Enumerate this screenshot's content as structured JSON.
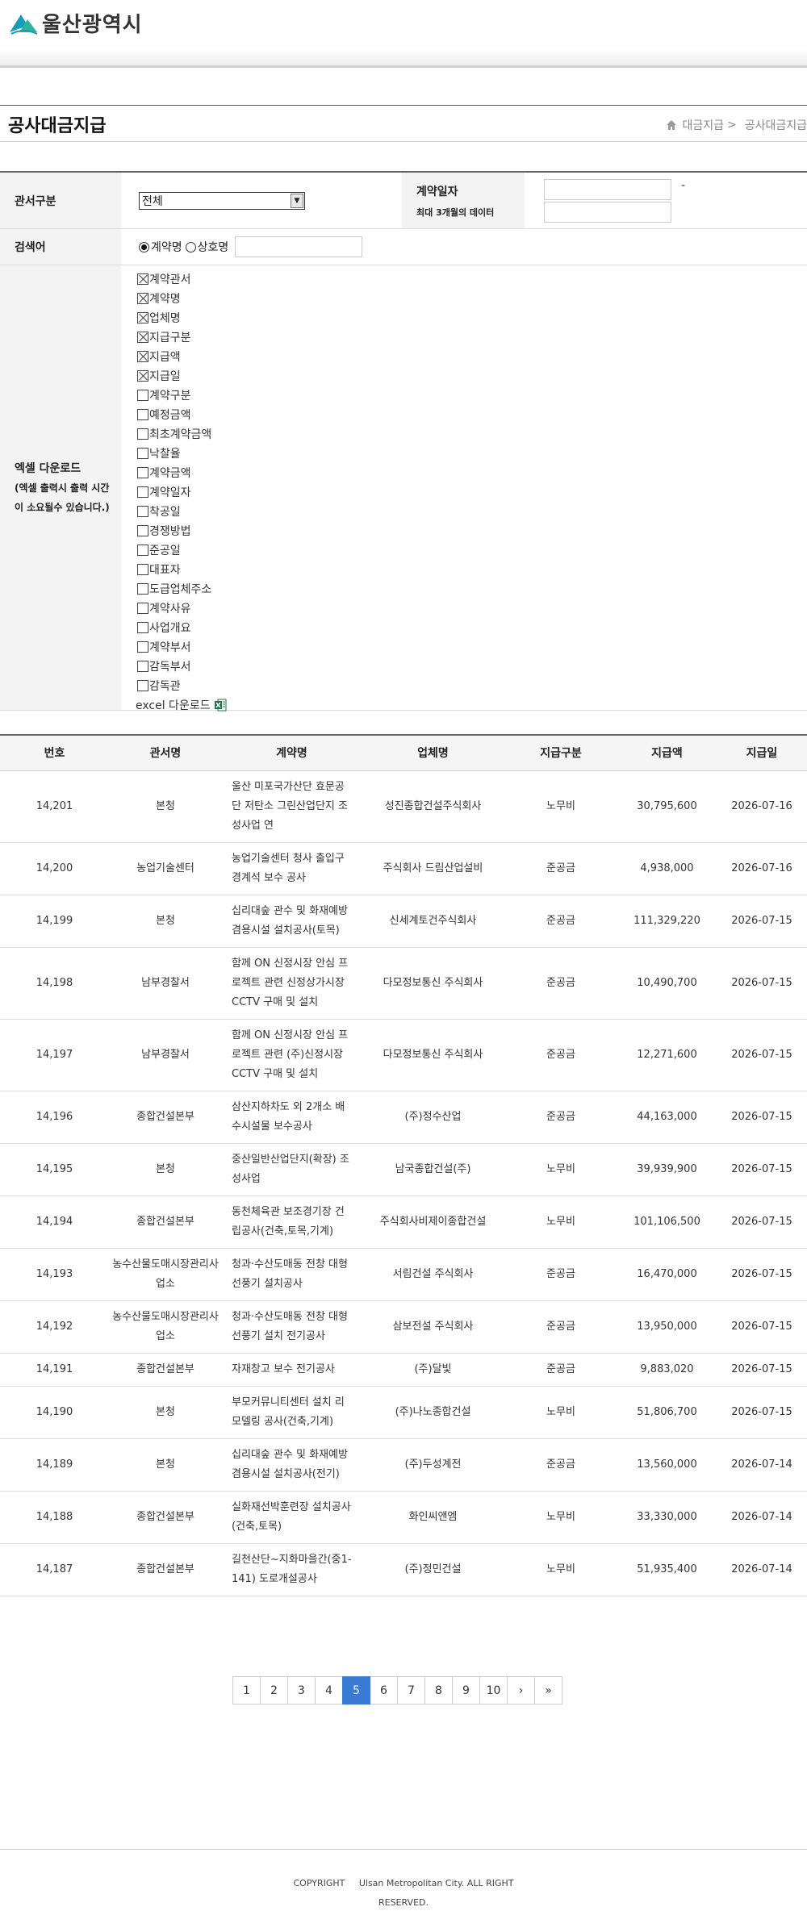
{
  "header": {
    "logo_text": "울산광역시",
    "brand_color": "#1a9bb8"
  },
  "page": {
    "title": "공사대금지급",
    "breadcrumb": [
      "대금지급",
      "공사대금지급"
    ],
    "breadcrumb_separator": ">"
  },
  "search": {
    "dept_label": "관서구분",
    "dept_selected": "전체",
    "date_label": "계약일자",
    "date_note": "최대 3개월의 데이터",
    "date_separator": "-",
    "date_from": "",
    "date_to": "",
    "keyword_label": "검색어",
    "radio_options": [
      {
        "label": "계약명",
        "checked": true
      },
      {
        "label": "상호명",
        "checked": false
      }
    ],
    "keyword_value": "",
    "excel_label": "엑셀 다운로드",
    "excel_note_1": "(엑셀 출력시 출력 시간",
    "excel_note_2": "이 소요될수 있습니다.)",
    "checkboxes": [
      {
        "label": "계약관서",
        "checked": true
      },
      {
        "label": "계약명",
        "checked": true
      },
      {
        "label": "업체명",
        "checked": true
      },
      {
        "label": "지급구분",
        "checked": true
      },
      {
        "label": "지급액",
        "checked": true
      },
      {
        "label": "지급일",
        "checked": true
      },
      {
        "label": "계약구분",
        "checked": false
      },
      {
        "label": "예정금액",
        "checked": false
      },
      {
        "label": "최초계약금액",
        "checked": false
      },
      {
        "label": "낙찰율",
        "checked": false
      },
      {
        "label": "계약금액",
        "checked": false
      },
      {
        "label": "계약일자",
        "checked": false
      },
      {
        "label": "착공일",
        "checked": false
      },
      {
        "label": "경쟁방법",
        "checked": false
      },
      {
        "label": "준공일",
        "checked": false
      },
      {
        "label": "대표자",
        "checked": false
      },
      {
        "label": "도급업체주소",
        "checked": false
      },
      {
        "label": "계약사유",
        "checked": false
      },
      {
        "label": "사업개요",
        "checked": false
      },
      {
        "label": "계약부서",
        "checked": false
      },
      {
        "label": "감독부서",
        "checked": false
      },
      {
        "label": "감독관",
        "checked": false
      }
    ],
    "excel_download_label": "excel 다운로드"
  },
  "table": {
    "columns": [
      "번호",
      "관서명",
      "계약명",
      "업체명",
      "지급구분",
      "지급액",
      "지급일"
    ],
    "rows": [
      [
        "14,201",
        "본청",
        "울산 미포국가산단 효문공단 저탄소 그린산업단지 조성사업 연",
        "성진종합건설주식회사",
        "노무비",
        "30,795,600",
        "2026-07-16"
      ],
      [
        "14,200",
        "농업기술센터",
        "농업기술센터 청사 출입구 경계석 보수 공사",
        "주식회사 드림산업설비",
        "준공금",
        "4,938,000",
        "2026-07-16"
      ],
      [
        "14,199",
        "본청",
        "십리대숲 관수 및 화재예방 겸용시설 설치공사(토목)",
        "신세계토건주식회사",
        "준공금",
        "111,329,220",
        "2026-07-15"
      ],
      [
        "14,198",
        "남부경찰서",
        "함께 ON 신정시장 안심 프로젝트 관련 신정상가시장 CCTV 구매 및 설치",
        "다모정보통신 주식회사",
        "준공금",
        "10,490,700",
        "2026-07-15"
      ],
      [
        "14,197",
        "남부경찰서",
        "함께 ON 신정시장 안심 프로젝트 관련 (주)신정시장 CCTV 구매 및 설치",
        "다모정보통신 주식회사",
        "준공금",
        "12,271,600",
        "2026-07-15"
      ],
      [
        "14,196",
        "종합건설본부",
        "삼산지하차도 외 2개소 배수시설물 보수공사",
        "(주)정수산업",
        "준공금",
        "44,163,000",
        "2026-07-15"
      ],
      [
        "14,195",
        "본청",
        "중산일반산업단지(확장) 조성사업",
        "남국종합건설(주)",
        "노무비",
        "39,939,900",
        "2026-07-15"
      ],
      [
        "14,194",
        "종합건설본부",
        "동천체육관 보조경기장 건립공사(건축,토목,기계)",
        "주식회사비제이종합건설",
        "노무비",
        "101,106,500",
        "2026-07-15"
      ],
      [
        "14,193",
        "농수산물도매시장관리사업소",
        "청과·수산도매동 전창 대형 선풍기 설치공사",
        "서림건설 주식회사",
        "준공금",
        "16,470,000",
        "2026-07-15"
      ],
      [
        "14,192",
        "농수산물도매시장관리사업소",
        "청과·수산도매동 전창 대형 선풍기 설치 전기공사",
        "삼보전설 주식회사",
        "준공금",
        "13,950,000",
        "2026-07-15"
      ],
      [
        "14,191",
        "종합건설본부",
        "자재창고 보수 전기공사",
        "(주)달빛",
        "준공금",
        "9,883,020",
        "2026-07-15"
      ],
      [
        "14,190",
        "본청",
        "부모커뮤니티센터 설치 리모델링 공사(건축,기계)",
        "(주)나노종합건설",
        "노무비",
        "51,806,700",
        "2026-07-15"
      ],
      [
        "14,189",
        "본청",
        "십리대숲 관수 및 화재예방 겸용시설 설치공사(전기)",
        "(주)두성계전",
        "준공금",
        "13,560,000",
        "2026-07-14"
      ],
      [
        "14,188",
        "종합건설본부",
        "실화재선박훈련장 설치공사(건축,토목)",
        "화인씨앤엠",
        "노무비",
        "33,330,000",
        "2026-07-14"
      ],
      [
        "14,187",
        "종합건설본부",
        "길천산단~지화마을간(중1-141) 도로개설공사",
        "(주)정민건설",
        "노무비",
        "51,935,400",
        "2026-07-14"
      ]
    ]
  },
  "pagination": {
    "pages": [
      "1",
      "2",
      "3",
      "4",
      "5",
      "6",
      "7",
      "8",
      "9",
      "10"
    ],
    "current": "5",
    "next": "›",
    "last": "»"
  },
  "footer": {
    "copyright_line1": "COPYRIGHT     Ulsan Metropolitan City. ALL RIGHT",
    "copyright_line2": "RESERVED."
  }
}
